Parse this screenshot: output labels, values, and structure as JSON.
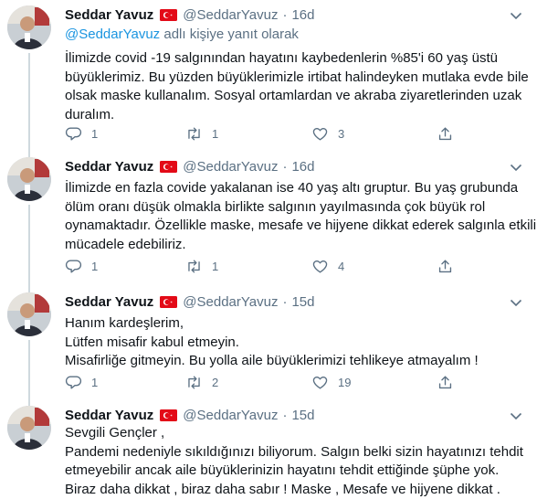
{
  "tweets": [
    {
      "author_name": "Seddar Yavuz",
      "handle": "@SeddarYavuz",
      "time": "16d",
      "reply_to_mention": "@SeddarYavuz",
      "reply_to_suffix": " adlı kişiye yanıt olarak",
      "lines": [
        "İlimizde covid -19 salgınından hayatını kaybedenlerin %85'i 60 yaş üstü",
        "büyüklerimiz. Bu yüzden büyüklerimizle irtibat halindeyken mutlaka evde bile",
        "olsak maske kullanalım. Sosyal ortamlardan ve akraba ziyaretlerinden uzak",
        "duralım."
      ],
      "replies": "1",
      "retweets": "1",
      "likes": "3"
    },
    {
      "author_name": "Seddar Yavuz",
      "handle": "@SeddarYavuz",
      "time": "16d",
      "lines": [
        "İlimizde en fazla covide yakalanan ise 40 yaş altı gruptur. Bu yaş grubunda",
        "ölüm oranı düşük olmakla birlikte salgının yayılmasında çok büyük rol",
        "oynamaktadır. Özellikle maske, mesafe ve hijyene dikkat ederek salgınla etkili",
        "mücadele edebiliriz."
      ],
      "replies": "1",
      "retweets": "1",
      "likes": "4"
    },
    {
      "author_name": "Seddar Yavuz",
      "handle": "@SeddarYavuz",
      "time": "15d",
      "lines": [
        "Hanım kardeşlerim,",
        "Lütfen misafir kabul etmeyin.",
        "Misafirliğe gitmeyin. Bu yolla aile büyüklerimizi tehlikeye atmayalım !"
      ],
      "replies": "1",
      "retweets": "2",
      "likes": "19"
    },
    {
      "author_name": "Seddar Yavuz",
      "handle": "@SeddarYavuz",
      "time": "15d",
      "lines": [
        "Sevgili Gençler ,",
        "Pandemi nedeniyle sıkıldığınızı biliyorum. Salgın belki sizin hayatınızı tehdit",
        "etmeyebilir ancak aile büyüklerinizin hayatını tehdit ettiğinde şüphe yok.",
        "Biraz daha dikkat , biraz daha sabır ! Maske , Mesafe ve hijyene dikkat ."
      ]
    }
  ],
  "separator": "·",
  "colors": {
    "text": "#0f1419",
    "secondary": "#5b7083",
    "link": "#1b95e0",
    "flag_red": "#e30a17",
    "divider": "#e6ecf0"
  },
  "icons": [
    "turkey-flag-icon",
    "chevron-down-icon",
    "reply-icon",
    "retweet-icon",
    "like-icon",
    "share-icon"
  ]
}
